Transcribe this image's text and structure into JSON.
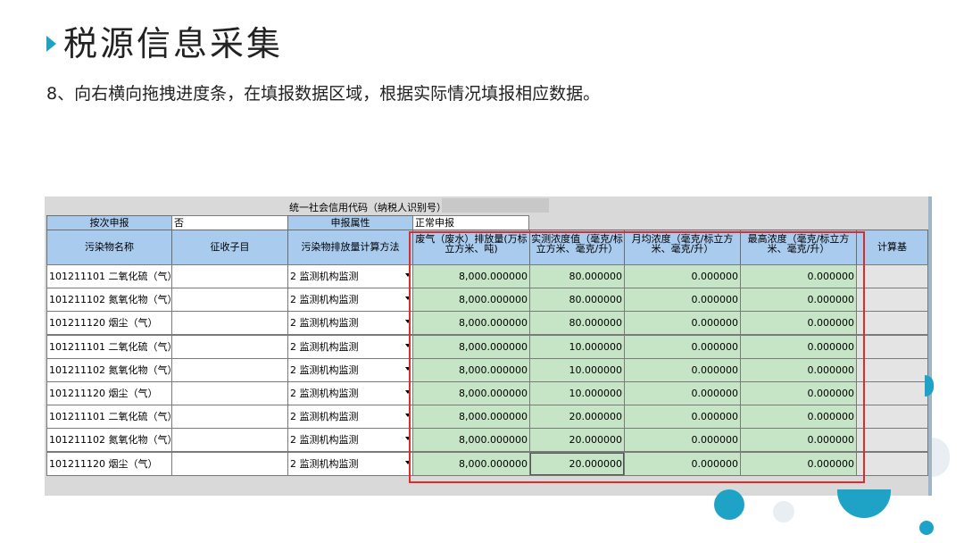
{
  "slide": {
    "title": "税源信息采集",
    "instruction": "8、向右横向拖拽进度条，在填报数据区域，根据实际情况填报相应数据。"
  },
  "form": {
    "uscc_label": "统一社会信用代码（纳税人识别号）：",
    "filing_by_time_label": "按次申报",
    "filing_by_time_value": "否",
    "filing_attr_label": "申报属性",
    "filing_attr_value": "正常申报",
    "columns": [
      "污染物名称",
      "征收子目",
      "污染物排放量计算方法",
      "废气（废水）排放量(万标立方米、吨)",
      "实测浓度值（毫克/标立方米、毫克/升）",
      "月均浓度（毫克/标立方米、毫克/升）",
      "最高浓度（毫克/标立方米、毫克/升）",
      "计算基"
    ],
    "rows": [
      {
        "pollutant": "101211101 二氧化硫（气）",
        "sub_item": "",
        "method": "2 监测机构监测",
        "emission": "8,000.000000",
        "measured": "80.000000",
        "monthly_avg": "0.000000",
        "max": "0.000000"
      },
      {
        "pollutant": "101211102 氮氧化物（气）",
        "sub_item": "",
        "method": "2 监测机构监测",
        "emission": "8,000.000000",
        "measured": "80.000000",
        "monthly_avg": "0.000000",
        "max": "0.000000"
      },
      {
        "pollutant": "101211120 烟尘（气）",
        "sub_item": "",
        "method": "2 监测机构监测",
        "emission": "8,000.000000",
        "measured": "80.000000",
        "monthly_avg": "0.000000",
        "max": "0.000000"
      },
      {
        "pollutant": "101211101 二氧化硫（气）",
        "sub_item": "",
        "method": "2 监测机构监测",
        "emission": "8,000.000000",
        "measured": "10.000000",
        "monthly_avg": "0.000000",
        "max": "0.000000"
      },
      {
        "pollutant": "101211102 氮氧化物（气）",
        "sub_item": "",
        "method": "2 监测机构监测",
        "emission": "8,000.000000",
        "measured": "10.000000",
        "monthly_avg": "0.000000",
        "max": "0.000000"
      },
      {
        "pollutant": "101211120 烟尘（气）",
        "sub_item": "",
        "method": "2 监测机构监测",
        "emission": "8,000.000000",
        "measured": "10.000000",
        "monthly_avg": "0.000000",
        "max": "0.000000"
      },
      {
        "pollutant": "101211101 二氧化硫（气）",
        "sub_item": "",
        "method": "2 监测机构监测",
        "emission": "8,000.000000",
        "measured": "20.000000",
        "monthly_avg": "0.000000",
        "max": "0.000000"
      },
      {
        "pollutant": "101211102 氮氧化物（气）",
        "sub_item": "",
        "method": "2 监测机构监测",
        "emission": "8,000.000000",
        "measured": "20.000000",
        "monthly_avg": "0.000000",
        "max": "0.000000"
      },
      {
        "pollutant": "101211120 烟尘（气）",
        "sub_item": "",
        "method": "2 监测机构监测",
        "emission": "8,000.000000",
        "measured": "20.000000",
        "monthly_avg": "0.000000",
        "max": "0.000000"
      }
    ]
  },
  "colors": {
    "accent": "#1ea3c6",
    "header_bg": "#a9cbee",
    "editable_bg": "#c6e4c6",
    "highlight": "#e02b2b"
  }
}
